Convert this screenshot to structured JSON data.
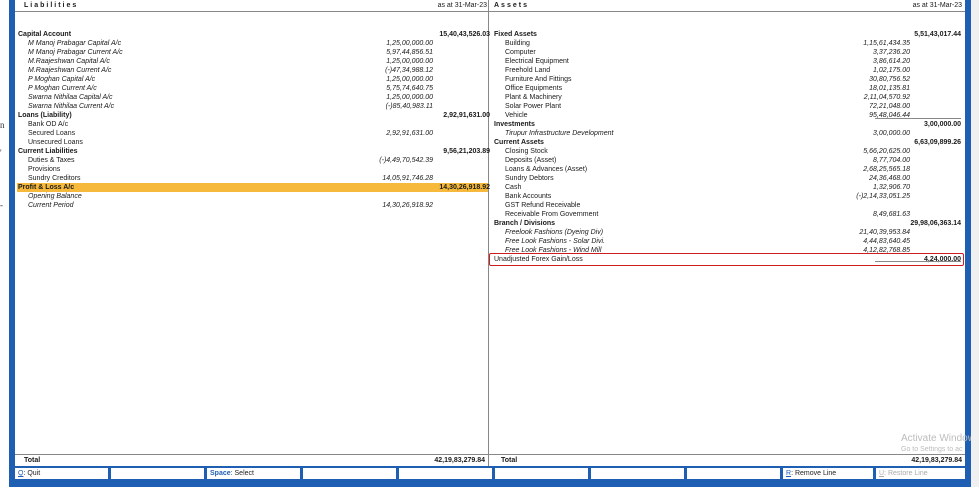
{
  "left_edge_glyphs": [
    "n",
    "'",
    "-"
  ],
  "header": {
    "left_title": "Liabilities",
    "left_date": "as at 31-Mar-23",
    "right_title": "Assets",
    "right_date": "as at 31-Mar-23"
  },
  "liabilities": [
    {
      "label": "Capital Account",
      "amt1": "",
      "amt2": "15,40,43,526.03",
      "kind": "group"
    },
    {
      "label": "M Manoj Prabagar Capital A/c",
      "amt1": "1,25,00,000.00",
      "amt2": "",
      "kind": "italic"
    },
    {
      "label": "M Manoj Prabagar Current A/c",
      "amt1": "5,97,44,856.51",
      "amt2": "",
      "kind": "italic"
    },
    {
      "label": "M.Raajeshwan Capital A/c",
      "amt1": "1,25,00,000.00",
      "amt2": "",
      "kind": "italic"
    },
    {
      "label": "M.Raajeshwan Current A/c",
      "amt1": "(-)47,34,988.12",
      "amt2": "",
      "kind": "italic"
    },
    {
      "label": "P Moghan Capital A/c",
      "amt1": "1,25,00,000.00",
      "amt2": "",
      "kind": "italic"
    },
    {
      "label": "P Moghan Current A/c",
      "amt1": "5,75,74,640.75",
      "amt2": "",
      "kind": "italic"
    },
    {
      "label": "Swarna Nithilaa Capital A/c",
      "amt1": "1,25,00,000.00",
      "amt2": "",
      "kind": "italic"
    },
    {
      "label": "Swarna Nithilaa Current A/c",
      "amt1": "(-)85,40,983.11",
      "amt2": "",
      "kind": "italic"
    },
    {
      "label": "Loans (Liability)",
      "amt1": "",
      "amt2": "2,92,91,631.00",
      "kind": "group"
    },
    {
      "label": "Bank OD A/c",
      "amt1": "",
      "amt2": "",
      "kind": "sub"
    },
    {
      "label": "Secured Loans",
      "amt1": "2,92,91,631.00",
      "amt2": "",
      "kind": "sub"
    },
    {
      "label": "Unsecured Loans",
      "amt1": "",
      "amt2": "",
      "kind": "sub"
    },
    {
      "label": "Current Liabilities",
      "amt1": "",
      "amt2": "9,56,21,203.89",
      "kind": "group"
    },
    {
      "label": "Duties & Taxes",
      "amt1": "(-)4,49,70,542.39",
      "amt2": "",
      "kind": "sub"
    },
    {
      "label": "Provisions",
      "amt1": "",
      "amt2": "",
      "kind": "sub"
    },
    {
      "label": "Sundry Creditors",
      "amt1": "14,05,91,746.28",
      "amt2": "",
      "kind": "sub"
    },
    {
      "label": "Profit & Loss A/c",
      "amt1": "",
      "amt2": "14,30,26,918.92",
      "kind": "highlight"
    },
    {
      "label": "Opening Balance",
      "amt1": "",
      "amt2": "",
      "kind": "italic"
    },
    {
      "label": "Current Period",
      "amt1": "14,30,26,918.92",
      "amt2": "",
      "kind": "italic"
    }
  ],
  "assets": [
    {
      "label": "Fixed Assets",
      "amt1": "",
      "amt2": "5,51,43,017.44",
      "kind": "group"
    },
    {
      "label": "Building",
      "amt1": "1,15,61,434.35",
      "amt2": "",
      "kind": "sub"
    },
    {
      "label": "Computer",
      "amt1": "3,37,236.20",
      "amt2": "",
      "kind": "sub"
    },
    {
      "label": "Electrical Equipment",
      "amt1": "3,86,614.20",
      "amt2": "",
      "kind": "sub"
    },
    {
      "label": "Freehold Land",
      "amt1": "1,02,175.00",
      "amt2": "",
      "kind": "sub"
    },
    {
      "label": "Furniture And Fittings",
      "amt1": "30,80,756.52",
      "amt2": "",
      "kind": "sub"
    },
    {
      "label": "Office Equipments",
      "amt1": "18,01,135.81",
      "amt2": "",
      "kind": "sub"
    },
    {
      "label": "Plant & Machinery",
      "amt1": "2,11,04,570.92",
      "amt2": "",
      "kind": "sub"
    },
    {
      "label": "Solar Power Plant",
      "amt1": "72,21,048.00",
      "amt2": "",
      "kind": "sub"
    },
    {
      "label": "Vehicle",
      "amt1": "95,48,046.44",
      "amt2": "",
      "kind": "sub"
    },
    {
      "label": "Investments",
      "amt1": "",
      "amt2": "3,00,000.00",
      "kind": "group"
    },
    {
      "label": "Tirupur Infrastructure Development",
      "amt1": "3,00,000.00",
      "amt2": "",
      "kind": "italic"
    },
    {
      "label": "Current Assets",
      "amt1": "",
      "amt2": "6,63,09,899.26",
      "kind": "group"
    },
    {
      "label": "Closing Stock",
      "amt1": "5,66,20,625.00",
      "amt2": "",
      "kind": "sub"
    },
    {
      "label": "Deposits (Asset)",
      "amt1": "8,77,704.00",
      "amt2": "",
      "kind": "sub"
    },
    {
      "label": "Loans & Advances (Asset)",
      "amt1": "2,68,25,565.18",
      "amt2": "",
      "kind": "sub"
    },
    {
      "label": "Sundry Debtors",
      "amt1": "24,36,468.00",
      "amt2": "",
      "kind": "sub"
    },
    {
      "label": "Cash",
      "amt1": "1,32,906.70",
      "amt2": "",
      "kind": "sub"
    },
    {
      "label": "Bank Accounts",
      "amt1": "(-)2,14,33,051.25",
      "amt2": "",
      "kind": "sub"
    },
    {
      "label": "GST Refund Receivable",
      "amt1": "",
      "amt2": "",
      "kind": "sub"
    },
    {
      "label": "Receivable From Government",
      "amt1": "8,49,681.63",
      "amt2": "",
      "kind": "sub"
    },
    {
      "label": "Branch / Divisions",
      "amt1": "",
      "amt2": "29,98,06,363.14",
      "kind": "group"
    },
    {
      "label": "Freelook Fashions (Dyeing Div)",
      "amt1": "21,40,39,953.84",
      "amt2": "",
      "kind": "italic"
    },
    {
      "label": "Free Look Fashions - Solar Divi.",
      "amt1": "4,44,83,640.45",
      "amt2": "",
      "kind": "italic"
    },
    {
      "label": "Free Look Fashions - Wind Mill",
      "amt1": "4,12,82,768.85",
      "amt2": "",
      "kind": "italic"
    },
    {
      "label": "Unadjusted Forex Gain/Loss",
      "amt1": "",
      "amt2": "4,24,000.00",
      "kind": "boxed"
    }
  ],
  "totals": {
    "left_label": "Total",
    "left_value": "42,19,83,279.84",
    "right_label": "Total",
    "right_value": "42,19,83,279.84"
  },
  "footer": {
    "quit_key": "Q",
    "quit_label": ": Quit",
    "space_key": "Space",
    "select_label": ": Select",
    "remove_key": "R",
    "remove_label": ": Remove Line",
    "restore_key": "U",
    "restore_label": ": Restore Line"
  },
  "watermark": {
    "title": "Activate Windows",
    "subtitle": "Go to Settings to activate Windows."
  }
}
